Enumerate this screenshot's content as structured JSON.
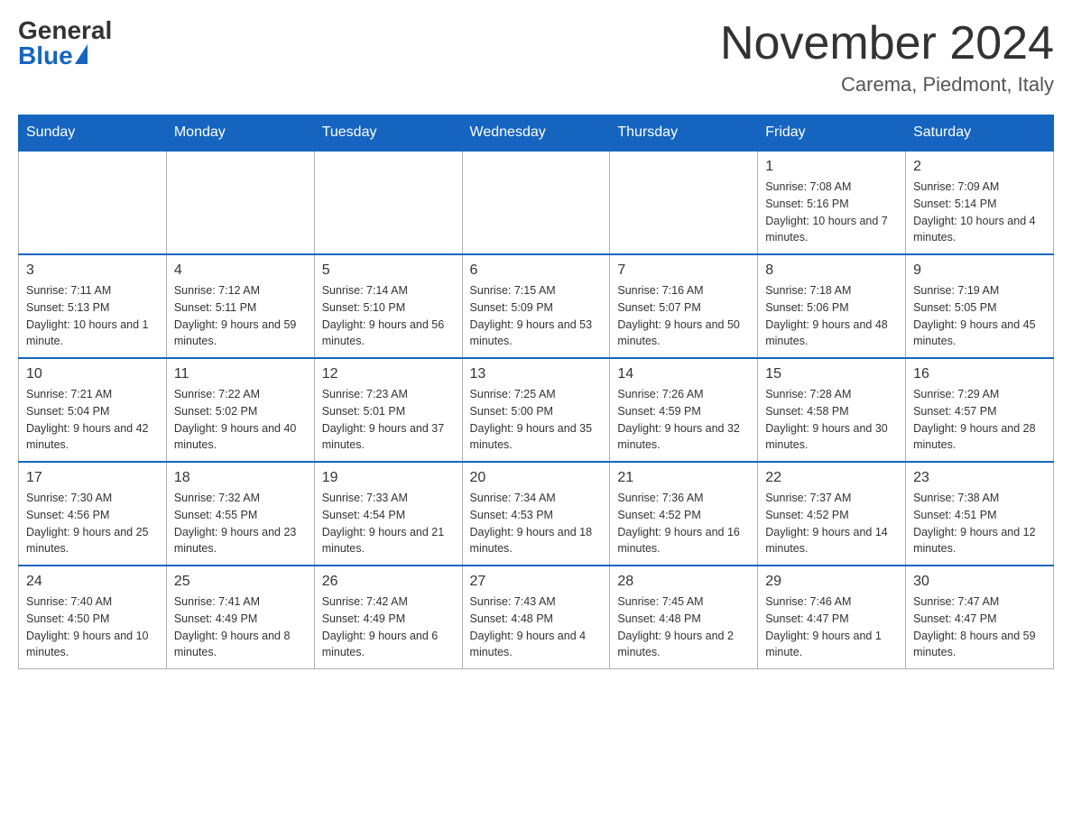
{
  "header": {
    "logo_general": "General",
    "logo_blue": "Blue",
    "month_title": "November 2024",
    "location": "Carema, Piedmont, Italy"
  },
  "days_of_week": [
    "Sunday",
    "Monday",
    "Tuesday",
    "Wednesday",
    "Thursday",
    "Friday",
    "Saturday"
  ],
  "weeks": [
    [
      {
        "day": "",
        "info": ""
      },
      {
        "day": "",
        "info": ""
      },
      {
        "day": "",
        "info": ""
      },
      {
        "day": "",
        "info": ""
      },
      {
        "day": "",
        "info": ""
      },
      {
        "day": "1",
        "info": "Sunrise: 7:08 AM\nSunset: 5:16 PM\nDaylight: 10 hours and 7 minutes."
      },
      {
        "day": "2",
        "info": "Sunrise: 7:09 AM\nSunset: 5:14 PM\nDaylight: 10 hours and 4 minutes."
      }
    ],
    [
      {
        "day": "3",
        "info": "Sunrise: 7:11 AM\nSunset: 5:13 PM\nDaylight: 10 hours and 1 minute."
      },
      {
        "day": "4",
        "info": "Sunrise: 7:12 AM\nSunset: 5:11 PM\nDaylight: 9 hours and 59 minutes."
      },
      {
        "day": "5",
        "info": "Sunrise: 7:14 AM\nSunset: 5:10 PM\nDaylight: 9 hours and 56 minutes."
      },
      {
        "day": "6",
        "info": "Sunrise: 7:15 AM\nSunset: 5:09 PM\nDaylight: 9 hours and 53 minutes."
      },
      {
        "day": "7",
        "info": "Sunrise: 7:16 AM\nSunset: 5:07 PM\nDaylight: 9 hours and 50 minutes."
      },
      {
        "day": "8",
        "info": "Sunrise: 7:18 AM\nSunset: 5:06 PM\nDaylight: 9 hours and 48 minutes."
      },
      {
        "day": "9",
        "info": "Sunrise: 7:19 AM\nSunset: 5:05 PM\nDaylight: 9 hours and 45 minutes."
      }
    ],
    [
      {
        "day": "10",
        "info": "Sunrise: 7:21 AM\nSunset: 5:04 PM\nDaylight: 9 hours and 42 minutes."
      },
      {
        "day": "11",
        "info": "Sunrise: 7:22 AM\nSunset: 5:02 PM\nDaylight: 9 hours and 40 minutes."
      },
      {
        "day": "12",
        "info": "Sunrise: 7:23 AM\nSunset: 5:01 PM\nDaylight: 9 hours and 37 minutes."
      },
      {
        "day": "13",
        "info": "Sunrise: 7:25 AM\nSunset: 5:00 PM\nDaylight: 9 hours and 35 minutes."
      },
      {
        "day": "14",
        "info": "Sunrise: 7:26 AM\nSunset: 4:59 PM\nDaylight: 9 hours and 32 minutes."
      },
      {
        "day": "15",
        "info": "Sunrise: 7:28 AM\nSunset: 4:58 PM\nDaylight: 9 hours and 30 minutes."
      },
      {
        "day": "16",
        "info": "Sunrise: 7:29 AM\nSunset: 4:57 PM\nDaylight: 9 hours and 28 minutes."
      }
    ],
    [
      {
        "day": "17",
        "info": "Sunrise: 7:30 AM\nSunset: 4:56 PM\nDaylight: 9 hours and 25 minutes."
      },
      {
        "day": "18",
        "info": "Sunrise: 7:32 AM\nSunset: 4:55 PM\nDaylight: 9 hours and 23 minutes."
      },
      {
        "day": "19",
        "info": "Sunrise: 7:33 AM\nSunset: 4:54 PM\nDaylight: 9 hours and 21 minutes."
      },
      {
        "day": "20",
        "info": "Sunrise: 7:34 AM\nSunset: 4:53 PM\nDaylight: 9 hours and 18 minutes."
      },
      {
        "day": "21",
        "info": "Sunrise: 7:36 AM\nSunset: 4:52 PM\nDaylight: 9 hours and 16 minutes."
      },
      {
        "day": "22",
        "info": "Sunrise: 7:37 AM\nSunset: 4:52 PM\nDaylight: 9 hours and 14 minutes."
      },
      {
        "day": "23",
        "info": "Sunrise: 7:38 AM\nSunset: 4:51 PM\nDaylight: 9 hours and 12 minutes."
      }
    ],
    [
      {
        "day": "24",
        "info": "Sunrise: 7:40 AM\nSunset: 4:50 PM\nDaylight: 9 hours and 10 minutes."
      },
      {
        "day": "25",
        "info": "Sunrise: 7:41 AM\nSunset: 4:49 PM\nDaylight: 9 hours and 8 minutes."
      },
      {
        "day": "26",
        "info": "Sunrise: 7:42 AM\nSunset: 4:49 PM\nDaylight: 9 hours and 6 minutes."
      },
      {
        "day": "27",
        "info": "Sunrise: 7:43 AM\nSunset: 4:48 PM\nDaylight: 9 hours and 4 minutes."
      },
      {
        "day": "28",
        "info": "Sunrise: 7:45 AM\nSunset: 4:48 PM\nDaylight: 9 hours and 2 minutes."
      },
      {
        "day": "29",
        "info": "Sunrise: 7:46 AM\nSunset: 4:47 PM\nDaylight: 9 hours and 1 minute."
      },
      {
        "day": "30",
        "info": "Sunrise: 7:47 AM\nSunset: 4:47 PM\nDaylight: 8 hours and 59 minutes."
      }
    ]
  ]
}
